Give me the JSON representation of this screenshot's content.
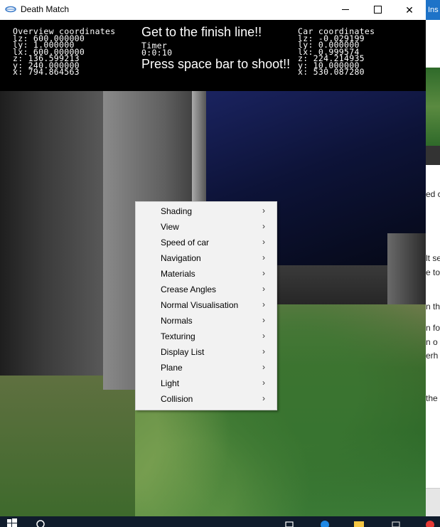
{
  "window": {
    "title": "Death Match",
    "minimize_label": "",
    "maximize_label": "",
    "close_label": "✕"
  },
  "hud": {
    "overview": {
      "heading": "Overview coordinates",
      "lines": [
        "lz: 600.000000",
        "ly: 1.000000",
        "lx: 600.000000",
        "z: 136.599213",
        "y: 240.000000",
        "x: 794.864563"
      ]
    },
    "center": {
      "goal": "Get to the finish line!!",
      "timer_label": "Timer",
      "timer_value": "0:0:10",
      "instruction": "Press space bar to shoot!!"
    },
    "car": {
      "heading": "Car coordinates",
      "lines": [
        "lz: -0.029199",
        "ly: 0.000000",
        "lx: 0.999574",
        "z: 224.214935",
        "y: 10.000000",
        "x: 530.087280"
      ]
    }
  },
  "menu": {
    "items": [
      {
        "label": "Shading"
      },
      {
        "label": "View"
      },
      {
        "label": "Speed of car"
      },
      {
        "label": "Navigation"
      },
      {
        "label": "Materials"
      },
      {
        "label": "Crease Angles"
      },
      {
        "label": "Normal Visualisation"
      },
      {
        "label": "Normals"
      },
      {
        "label": "Texturing"
      },
      {
        "label": "Display List"
      },
      {
        "label": "Plane"
      },
      {
        "label": "Light"
      },
      {
        "label": "Collision"
      }
    ],
    "submenu_arrow": "›"
  },
  "background_app": {
    "tab_text": "Ins",
    "fragments": [
      "ed c",
      "lt se",
      "e to",
      "n th",
      "n fo",
      "n o",
      "erh",
      "the"
    ]
  },
  "colors": {
    "hud_bg": "#000000",
    "menu_bg": "#f2f2f2",
    "taskbar_bg": "#101c2c"
  }
}
